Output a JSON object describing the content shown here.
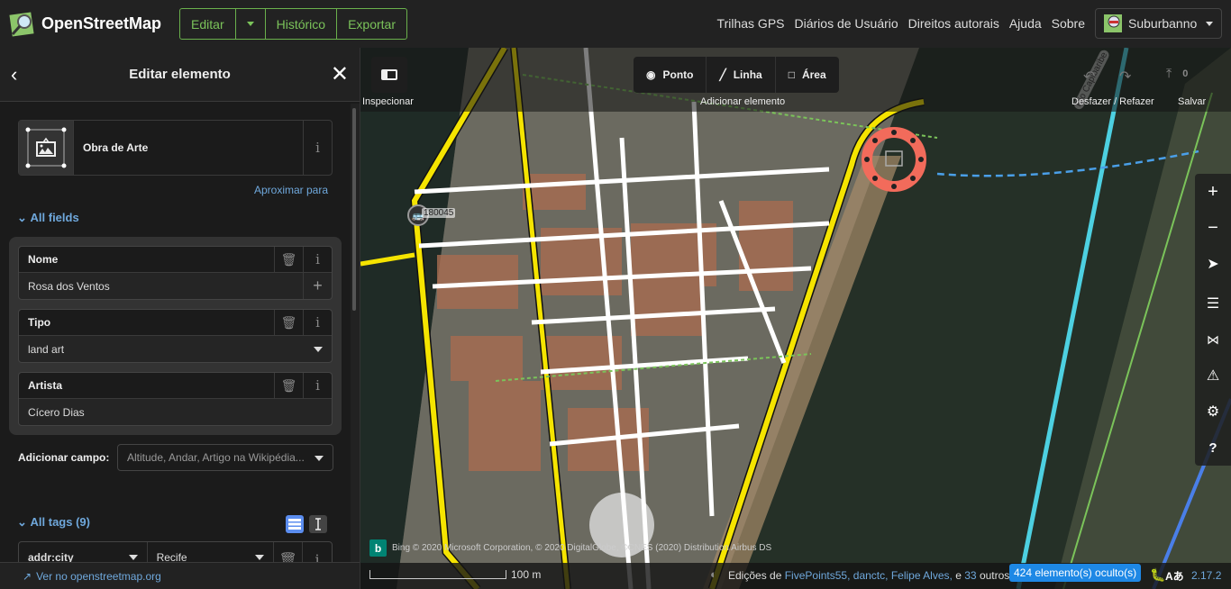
{
  "topbar": {
    "brand": "OpenStreetMap",
    "edit_label": "Editar",
    "history_label": "Histórico",
    "export_label": "Exportar",
    "nav_links": [
      "Trilhas GPS",
      "Diários de Usuário",
      "Direitos autorais",
      "Ajuda",
      "Sobre"
    ],
    "username": "Suburbanno"
  },
  "sidebar": {
    "title": "Editar elemento",
    "preset_name": "Obra de Arte",
    "zoom_to": "Aproximar para",
    "all_fields_label": "All fields",
    "fields": [
      {
        "label": "Nome",
        "value": "Rosa dos Ventos",
        "control": "add"
      },
      {
        "label": "Tipo",
        "value": "land art",
        "control": "dropdown"
      },
      {
        "label": "Artista",
        "value": "Cícero Dias",
        "control": "none"
      }
    ],
    "add_field_label": "Adicionar campo:",
    "add_field_placeholder": "Altitude, Andar, Artigo na Wikipédia...",
    "all_tags_label": "All tags (9)",
    "tags": [
      {
        "key": "addr:city",
        "value": "Recife"
      }
    ],
    "footer_link": "Ver no openstreetmap.org"
  },
  "map": {
    "inspect_label": "Inspecionar",
    "add_point": "Ponto",
    "add_line": "Linha",
    "add_area": "Área",
    "add_element_label": "Adicionar elemento",
    "undo_redo_label": "Desfazer / Refazer",
    "save_label": "Salvar",
    "save_count": "0",
    "bus_stop_ref": "180045",
    "river_label": "Rio Capibaribe",
    "attribution": "Bing  © 2020 Microsoft Corporation, © 2020 DigitalGlobe, ©CNES (2020) Distribution Airbus DS",
    "scale_label": "100 m",
    "edits_prefix": "Edições de",
    "editors": [
      "FivePoints55,",
      "danctc,",
      "Felipe Alves,"
    ],
    "edits_and": "e",
    "others_count": "33",
    "others_suffix": "outros",
    "hidden_badge": "424 elemento(s) oculto(s)",
    "version": "2.17.2"
  },
  "colors": {
    "accent_green": "#7bc35a",
    "link_blue": "#6fa8dc",
    "badge_blue": "#1e88e5",
    "selection_red": "#f26b5b"
  }
}
